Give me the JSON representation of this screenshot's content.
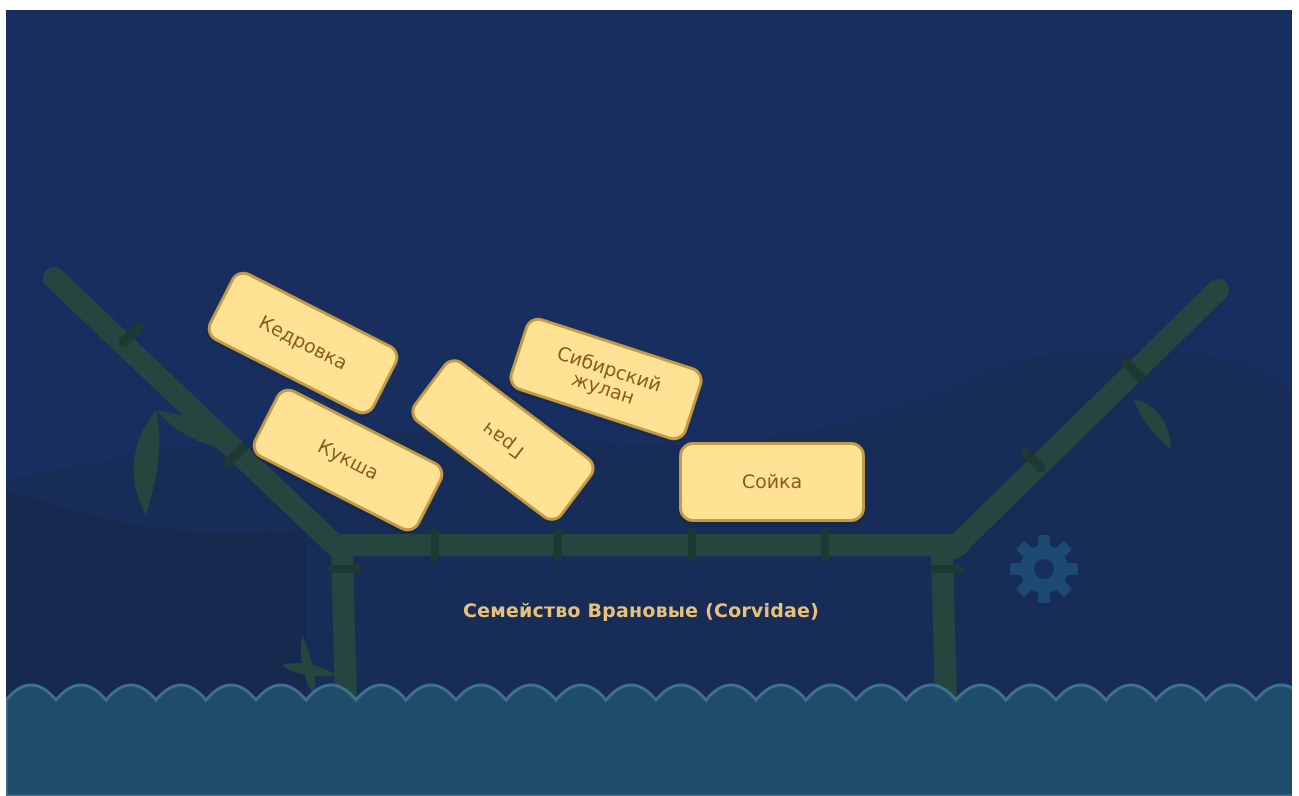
{
  "colors": {
    "background": "#182e5f",
    "water": "#1f4c68",
    "wave_line": "#3f6f91",
    "bamboo": "#27453f",
    "tile_fill": "#ffe294",
    "tile_border": "#c39a45",
    "tile_text": "#875c1d",
    "caption": "#e9c17b",
    "gear": "#1c4a73"
  },
  "tiles": {
    "kedrovka": "Кедровка",
    "kuksha": "Кукша",
    "grach": "Грач",
    "sibirsky_zhulan": "Сибирский\nжулан",
    "soyka": "Сойка"
  },
  "caption": "Семейство Врановые (Corvidae)",
  "icons": {
    "settings": "gear-icon"
  }
}
